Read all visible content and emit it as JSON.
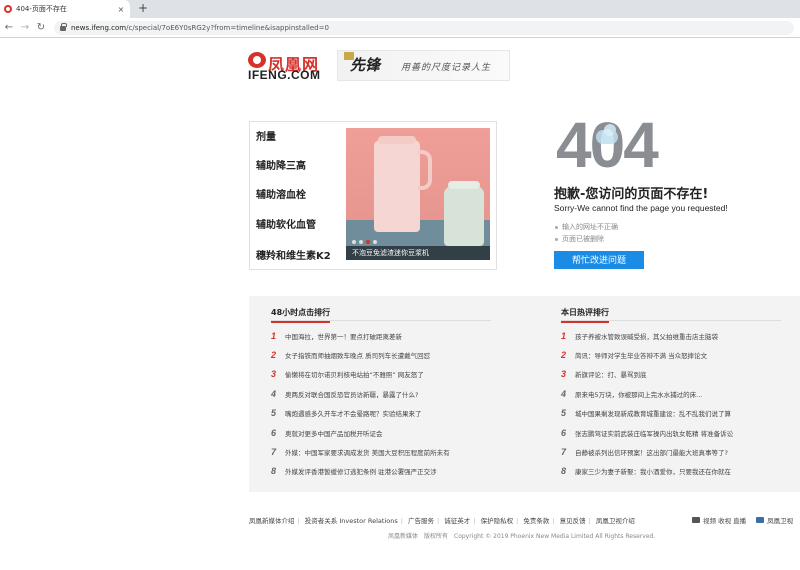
{
  "browser": {
    "tab_title": "404-页面不存在",
    "tab_close": "×",
    "new_tab": "+",
    "url_domain": "news.ifeng.com",
    "url_path": "/c/special/7oE6Y0sRG2y?from=timeline&isappinstalled=0"
  },
  "header": {
    "logo_cn": "凤凰网",
    "logo_en": "IFENG.COM",
    "banner_mark": "先锋",
    "banner_slogan": "用善的尺度记录人生"
  },
  "ad": {
    "items": [
      "剂量",
      "辅助降三高",
      "辅助溶血栓",
      "辅助软化血管",
      "穗羚和维生素K2"
    ],
    "caption": "不泡豆免滤渣迷你豆浆机"
  },
  "error": {
    "code": "404",
    "title": "抱歉-您访问的页面不存在!",
    "subtitle": "Sorry-We cannot find the page you requested!",
    "reasons": [
      "输入的网址不正确",
      "页面已被删除"
    ],
    "button": "帮忙改进问题"
  },
  "rankings": {
    "left": {
      "title": "48小时点击排行",
      "items": [
        {
          "n": "1",
          "text": "中国海拉，世界第一！要点打破距离差新"
        },
        {
          "n": "2",
          "text": "女子指铁而师抽烟致车晚点 质司列车长遭戴气回怼"
        },
        {
          "n": "3",
          "text": "偷懒将在切尔诺贝利核电站拍“不雅照” 网友怒了"
        },
        {
          "n": "4",
          "text": "奥两反对联合国反恐官员访新疆，暴露了什么?"
        },
        {
          "n": "5",
          "text": "嘴炮遇感多久开车才不会晕路呢？实验结果来了"
        },
        {
          "n": "6",
          "text": "奥就对更多中国产品加税开听证会"
        },
        {
          "n": "7",
          "text": "外媒：中国军家要求调成发货 美国大豆积压程度前所未有"
        },
        {
          "n": "8",
          "text": "外媒发评香港暂缓修订逃犯条例 驻港公署强严正交涉"
        }
      ]
    },
    "right": {
      "title": "本日热评排行",
      "items": [
        {
          "n": "1",
          "text": "孩子养被水管致误碱受损，其父拍维重击店主脑袋"
        },
        {
          "n": "2",
          "text": "简讯：导师对学生毕业答辩不满 当众怒摔论文"
        },
        {
          "n": "3",
          "text": "新旗评论：打、暴骂到底"
        },
        {
          "n": "4",
          "text": "原来电5万块，你被那间上完水水捕过的床..."
        },
        {
          "n": "5",
          "text": "城中国果剩发现新成教育城重建设：乱不乱我们说了算"
        },
        {
          "n": "6",
          "text": "张志鹏驾证实前武装庄临军操内出轨女乾精 将准备诉讼"
        },
        {
          "n": "7",
          "text": "自静被杀列出信环预案！这出部门最能大班真事等了?"
        },
        {
          "n": "8",
          "text": "康家三少为妻子新娶：我小酒爱你，只要我还在你就在"
        }
      ]
    }
  },
  "footer": {
    "links": [
      "凤凰新媒体介绍",
      "投资者关系 Investor Relations",
      "广告服务",
      "诚征英才",
      "保护隐私权",
      "免责条款",
      "意见反馈",
      "凤凰卫视介绍"
    ],
    "right": [
      "视频 收视 直播",
      "凤凰卫视"
    ],
    "copyright": "凤凰新媒体　版权所有　Copyright © 2019 Phoenix New Media Limited All Rights Reserved."
  }
}
